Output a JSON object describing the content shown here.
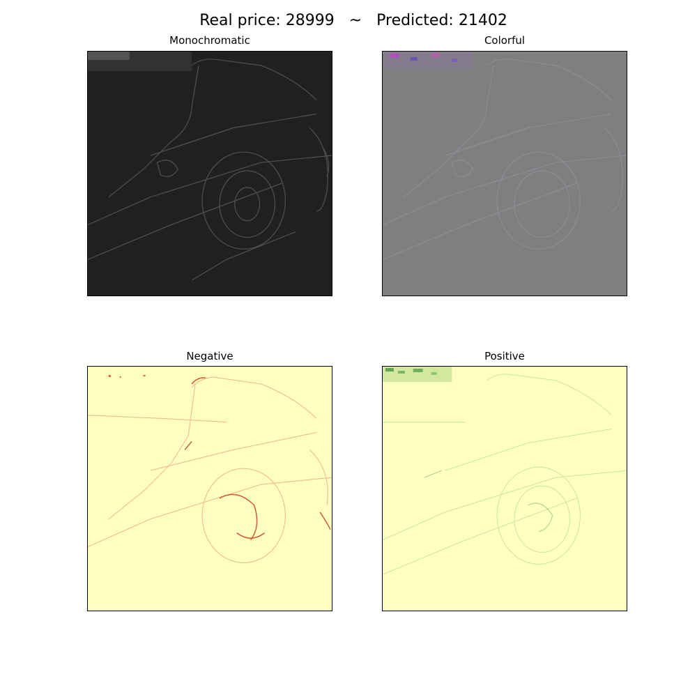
{
  "figure": {
    "suptitle": "Real price: 28999   ~   Predicted: 21402"
  },
  "panels": [
    {
      "title": "Monochromatic",
      "background": "#202020",
      "stroke": "#5a5a5a"
    },
    {
      "title": "Colorful",
      "background": "#7f7f7f",
      "stroke": "#8f8fa0"
    },
    {
      "title": "Negative",
      "background": "#ffffbf",
      "stroke": "#e8a070"
    },
    {
      "title": "Positive",
      "background": "#ffffbf",
      "stroke": "#b8dca0"
    }
  ]
}
